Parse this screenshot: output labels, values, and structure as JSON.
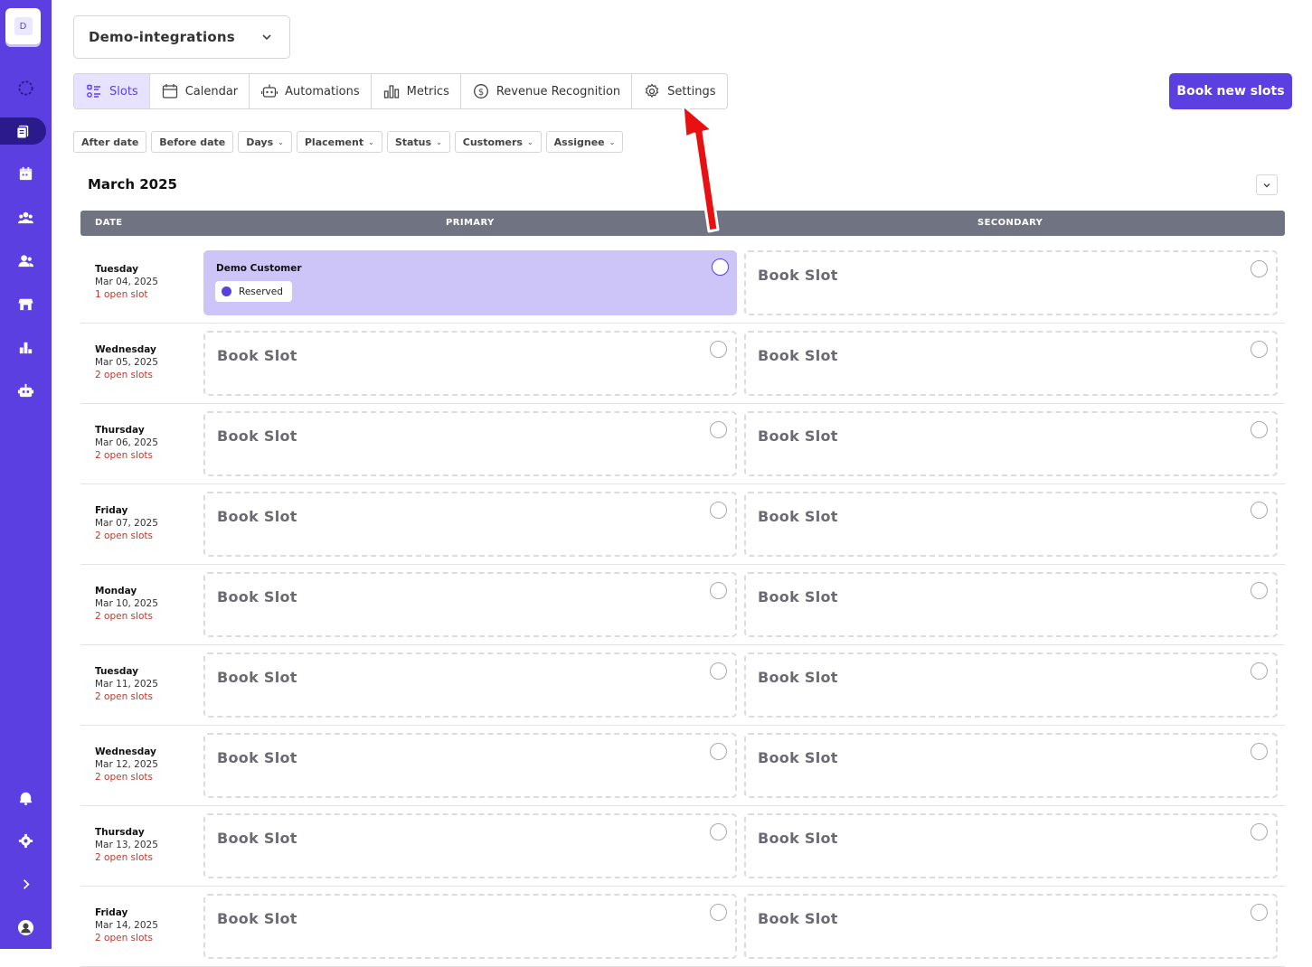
{
  "sidebar": {
    "workspace_initial": "D",
    "icons": [
      "loading-icon",
      "slots-icon",
      "calendar-icon",
      "team-icon",
      "contacts-icon",
      "store-icon",
      "metrics-icon",
      "bot-icon",
      "bell-icon",
      "settings-icon",
      "expand-icon",
      "user-avatar-icon"
    ]
  },
  "workspace": {
    "name": "Demo-integrations"
  },
  "tabs": [
    {
      "label": "Slots",
      "icon": "slots-icon",
      "active": true
    },
    {
      "label": "Calendar",
      "icon": "calendar-icon"
    },
    {
      "label": "Automations",
      "icon": "robot-icon"
    },
    {
      "label": "Metrics",
      "icon": "bar-chart-icon"
    },
    {
      "label": "Revenue Recognition",
      "icon": "dollar-icon"
    },
    {
      "label": "Settings",
      "icon": "gear-icon"
    }
  ],
  "book_button": "Book new slots",
  "filters": [
    {
      "label": "After date",
      "dropdown": false
    },
    {
      "label": "Before date",
      "dropdown": false
    },
    {
      "label": "Days",
      "dropdown": true
    },
    {
      "label": "Placement",
      "dropdown": true
    },
    {
      "label": "Status",
      "dropdown": true
    },
    {
      "label": "Customers",
      "dropdown": true
    },
    {
      "label": "Assignee",
      "dropdown": true
    }
  ],
  "month_title": "March 2025",
  "table_header": {
    "date": "DATE",
    "primary": "PRIMARY",
    "secondary": "SECONDARY"
  },
  "book_slot_label": "Book Slot",
  "rows": [
    {
      "day": "Tuesday",
      "date": "Mar 04, 2025",
      "open": "1 open slot",
      "primary": {
        "reserved": true,
        "customer": "Demo Customer",
        "status": "Reserved"
      }
    },
    {
      "day": "Wednesday",
      "date": "Mar 05, 2025",
      "open": "2 open slots"
    },
    {
      "day": "Thursday",
      "date": "Mar 06, 2025",
      "open": "2 open slots"
    },
    {
      "day": "Friday",
      "date": "Mar 07, 2025",
      "open": "2 open slots"
    },
    {
      "day": "Monday",
      "date": "Mar 10, 2025",
      "open": "2 open slots"
    },
    {
      "day": "Tuesday",
      "date": "Mar 11, 2025",
      "open": "2 open slots"
    },
    {
      "day": "Wednesday",
      "date": "Mar 12, 2025",
      "open": "2 open slots"
    },
    {
      "day": "Thursday",
      "date": "Mar 13, 2025",
      "open": "2 open slots"
    },
    {
      "day": "Friday",
      "date": "Mar 14, 2025",
      "open": "2 open slots"
    }
  ],
  "colors": {
    "accent": "#5b3fe0",
    "reserved_bg": "#cdc5f7",
    "open_text": "#c0392b",
    "header_bg": "#6f7382",
    "annotation_arrow": "#e81010"
  }
}
